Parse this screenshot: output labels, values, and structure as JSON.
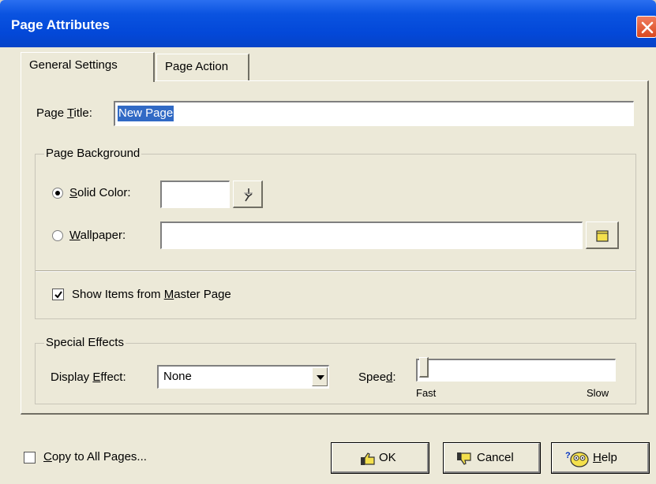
{
  "window": {
    "title": "Page Attributes"
  },
  "tabs": [
    {
      "label": "General Settings",
      "active": true
    },
    {
      "label": "Page Action",
      "active": false
    }
  ],
  "page_title": {
    "label_prefix": "Page ",
    "label_ul": "T",
    "label_suffix": "itle:",
    "value": "New Page"
  },
  "page_background": {
    "group_title": "Page Background",
    "solid_color": {
      "label_ul": "S",
      "label_rest": "olid Color:",
      "selected": true
    },
    "wallpaper": {
      "label_ul": "W",
      "label_rest": "allpaper:",
      "selected": false,
      "value": ""
    },
    "show_master": {
      "label_prefix": "Show Items from ",
      "label_ul": "M",
      "label_suffix": "aster Page",
      "checked": true
    }
  },
  "special_effects": {
    "group_title": "Special Effects",
    "display_effect": {
      "label_prefix": "Display ",
      "label_ul": "E",
      "label_suffix": "ffect:",
      "value": "None"
    },
    "speed": {
      "label_prefix": "Spee",
      "label_ul": "d",
      "label_suffix": ":",
      "min_label": "Fast",
      "max_label": "Slow",
      "level": 0
    }
  },
  "footer": {
    "copy_all": {
      "label_ul": "C",
      "label_rest": "opy to All Pages...",
      "checked": false
    },
    "ok_label": "OK",
    "cancel_label": "Cancel",
    "help_ul": "H",
    "help_rest": "elp"
  },
  "colors": {
    "titlebar": "#0348d8",
    "selection": "#316ac5",
    "face": "#ece9d8",
    "close": "#d8481f"
  }
}
